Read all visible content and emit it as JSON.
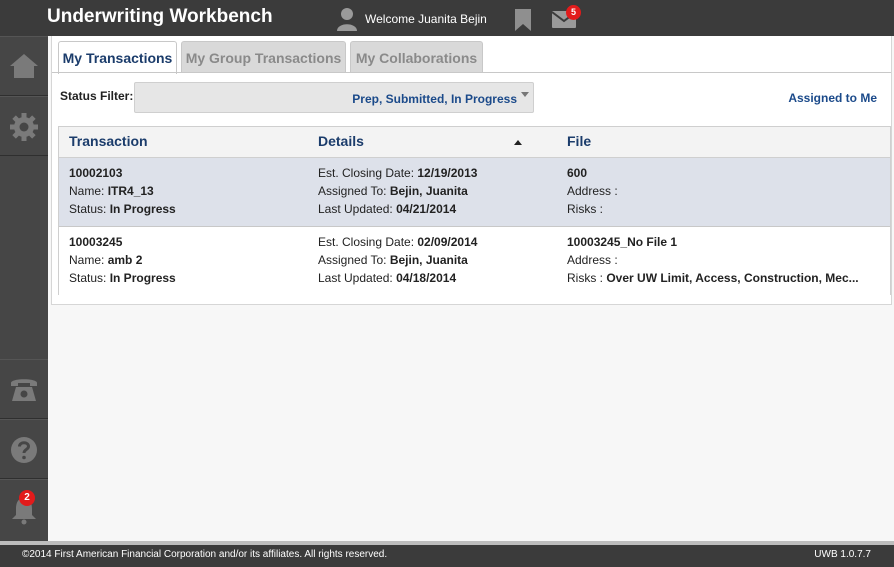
{
  "header": {
    "title": "Underwriting Workbench",
    "welcome": "Welcome Juanita Bejin",
    "mail_count": "5"
  },
  "sidebar": {
    "items": [
      {
        "icon": "home-icon"
      },
      {
        "icon": "gear-icon"
      },
      {
        "icon": "phone-icon"
      },
      {
        "icon": "help-icon"
      },
      {
        "icon": "bell-icon"
      }
    ],
    "notification_count": "2"
  },
  "tabs": [
    {
      "label": "My Transactions",
      "active": true
    },
    {
      "label": "My Group Transactions",
      "active": false
    },
    {
      "label": "My Collaborations",
      "active": false
    }
  ],
  "filter": {
    "label": "Status Filter:",
    "value": "Prep, Submitted, In Progress",
    "assigned_link": "Assigned to Me"
  },
  "table": {
    "columns": [
      "Transaction",
      "Details",
      "File"
    ],
    "rows": [
      {
        "id": "10002103",
        "name_label": "Name: ",
        "name": "ITR4_13",
        "status_label": "Status: ",
        "status": "In Progress",
        "closing_label": "Est. Closing Date: ",
        "closing": "12/19/2013",
        "assigned_label": "Assigned To: ",
        "assigned": "Bejin, Juanita",
        "updated_label": "Last Updated: ",
        "updated": "04/21/2014",
        "file": "600",
        "address_label": "Address : ",
        "address": "",
        "risks_label": "Risks : ",
        "risks": ""
      },
      {
        "id": "10003245",
        "name_label": "Name: ",
        "name": "amb 2",
        "status_label": "Status: ",
        "status": "In Progress",
        "closing_label": "Est. Closing Date: ",
        "closing": "02/09/2014",
        "assigned_label": "Assigned To: ",
        "assigned": "Bejin, Juanita",
        "updated_label": "Last Updated: ",
        "updated": "04/18/2014",
        "file": "10003245_No File 1",
        "address_label": "Address : ",
        "address": "",
        "risks_label": "Risks : ",
        "risks": "Over UW Limit, Access, Construction, Mec..."
      }
    ]
  },
  "footer": {
    "copyright": "©2014 First American Financial Corporation and/or its affiliates. All rights reserved.",
    "version": "UWB 1.0.7.7"
  },
  "colors": {
    "accent": "#1b3c6b",
    "link": "#1b4a8a",
    "badge": "#e21b1b",
    "chrome": "#3b3b3b"
  }
}
